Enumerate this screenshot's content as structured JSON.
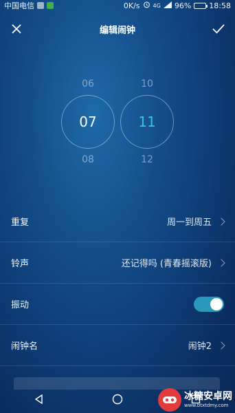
{
  "status_bar": {
    "carrier": "中国电信",
    "network_speed": "0K/s",
    "network_type": "4G",
    "battery_percent": "96%",
    "battery_level": 0.96,
    "time": "18:58"
  },
  "header": {
    "title": "编辑闹钟",
    "close_icon": "close-icon",
    "confirm_icon": "checkmark-icon"
  },
  "picker": {
    "hour": {
      "prev": "06",
      "selected": "07",
      "next": "08"
    },
    "minute": {
      "prev": "10",
      "selected": "11",
      "next": "12"
    }
  },
  "settings": [
    {
      "label": "重复",
      "value": "周一到周五",
      "type": "link"
    },
    {
      "label": "铃声",
      "value": "还记得吗 (青春摇滚版)",
      "type": "link"
    },
    {
      "label": "振动",
      "value": "",
      "type": "toggle",
      "on": true
    },
    {
      "label": "闹钟名",
      "value": "闹钟2",
      "type": "link"
    }
  ],
  "navigation": {
    "back_icon": "back-triangle-icon",
    "home_icon": "home-circle-icon",
    "recents_icon": "recents-square-icon"
  },
  "watermark": {
    "name": "冰糖安卓网",
    "url": "www.btxtdmy.com"
  },
  "colors": {
    "accent": "#35c4e8",
    "toggle_on": "#2a98b8",
    "watermark_red": "#e23b3b"
  }
}
